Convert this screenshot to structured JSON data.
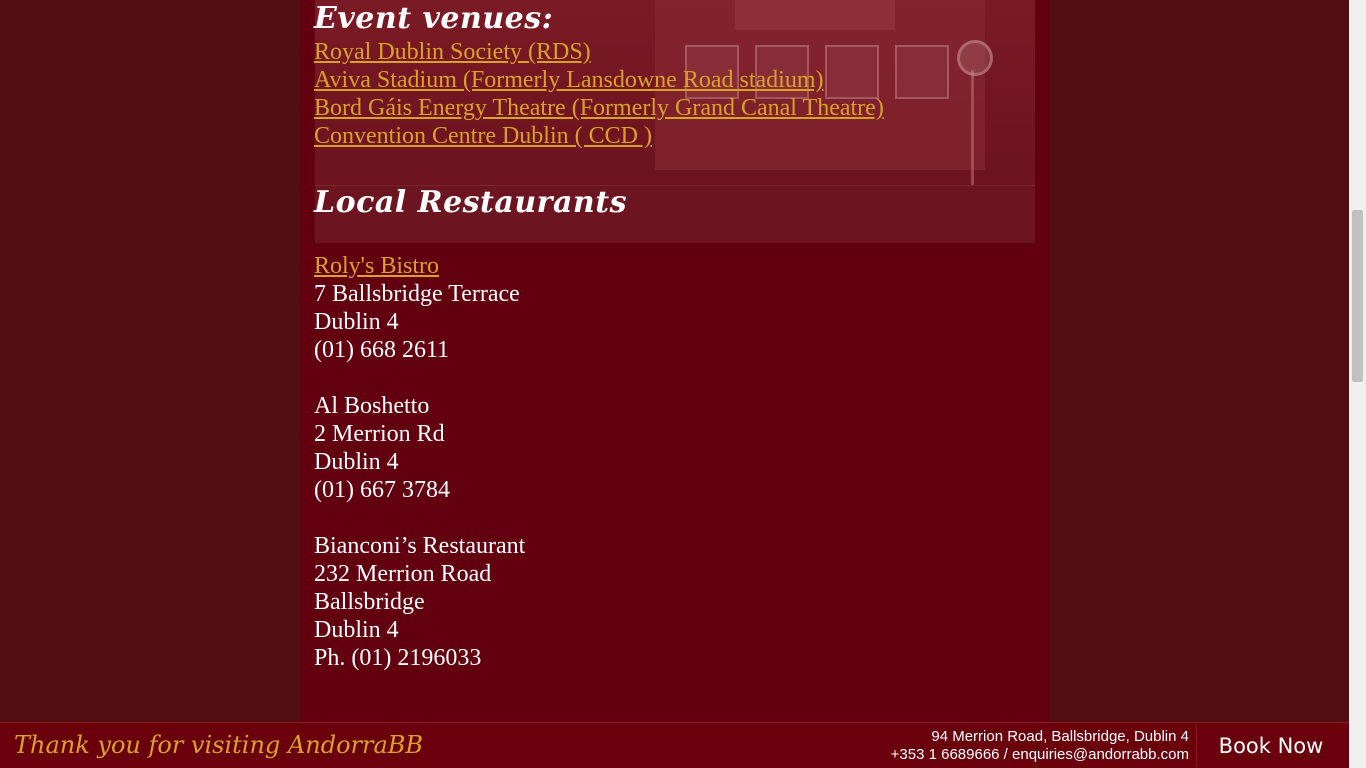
{
  "event_venues": {
    "heading": "Event venues:",
    "links": [
      "Royal Dublin Society (RDS)",
      "Aviva Stadium (Formerly Lansdowne Road stadium)",
      "Bord Gáis Energy Theatre (Formerly Grand Canal Theatre)",
      "Convention Centre Dublin ( CCD )"
    ]
  },
  "restaurants": {
    "heading": "Local Restaurants",
    "entries": [
      {
        "name": "Roly's Bistro",
        "lines": [
          "7 Ballsbridge Terrace",
          "Dublin 4",
          "(01) 668 2611"
        ]
      },
      {
        "name": "Al Boshetto",
        "lines": [
          "2 Merrion Rd",
          "Dublin 4",
          "(01) 667 3784"
        ]
      },
      {
        "name": "Bianconi’s Restaurant",
        "lines": [
          "232 Merrion Road",
          "Ballsbridge",
          "Dublin 4",
          "Ph. (01) 2196033"
        ]
      }
    ]
  },
  "footer": {
    "thanks": "Thank you for visiting AndorraBB",
    "address": "94 Merrion Road, Ballsbridge, Dublin 4",
    "contact": "+353 1 6689666 / enquiries@andorrabb.com",
    "book_label": "Book Now"
  },
  "colors": {
    "background": "#520f12",
    "content": "#620010",
    "link": "#d9a227",
    "footer": "#6b000d"
  }
}
